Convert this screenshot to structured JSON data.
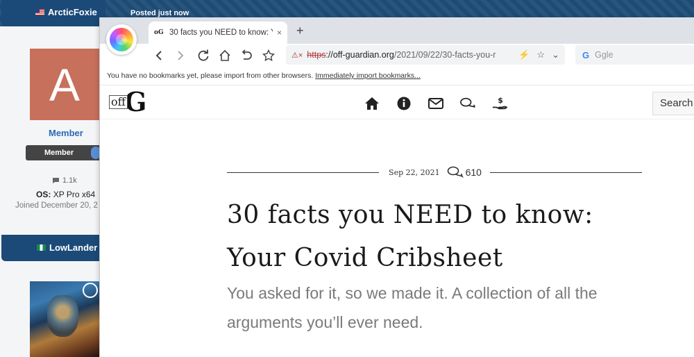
{
  "forum": {
    "user1": {
      "name": "ArcticFoxie",
      "posted": "Posted just now",
      "avatar_letter": "A",
      "role": "Member",
      "badge": "Member",
      "posts": "1.1k",
      "os_label": "OS:",
      "os_value": "XP Pro x64",
      "joined": "Joined December 20, 2"
    },
    "user2": {
      "name": "LowLander"
    }
  },
  "browser": {
    "tab_title": "30 facts you NEED to know: Y",
    "tab_close": "×",
    "new_tab": "+",
    "url": {
      "insecure": "⚠×",
      "scheme": "https",
      "host": "://off-guardian.org",
      "path": "/2021/09/22/30-facts-you-r"
    },
    "search_engine": "G",
    "search_placeholder": "Ggle",
    "bookmarks_text": "You have no bookmarks yet, please import from other browsers.",
    "bookmarks_link": "Immediately import bookmarks..."
  },
  "site": {
    "logo_small": "off",
    "logo_big": "G",
    "search_label": "Search",
    "date": "Sep 22, 2021",
    "comments": "610",
    "headline": "30 facts you NEED to know: Your Covid Cribsheet",
    "subhead": "You asked for it, so we made it. A collection of all the arguments you’ll ever need."
  },
  "colors": {
    "forum_bar": "#1f4e79",
    "avatar_bg": "#c7705b",
    "role_blue": "#2a6bb5",
    "subhead_gray": "#7a7a7a"
  }
}
